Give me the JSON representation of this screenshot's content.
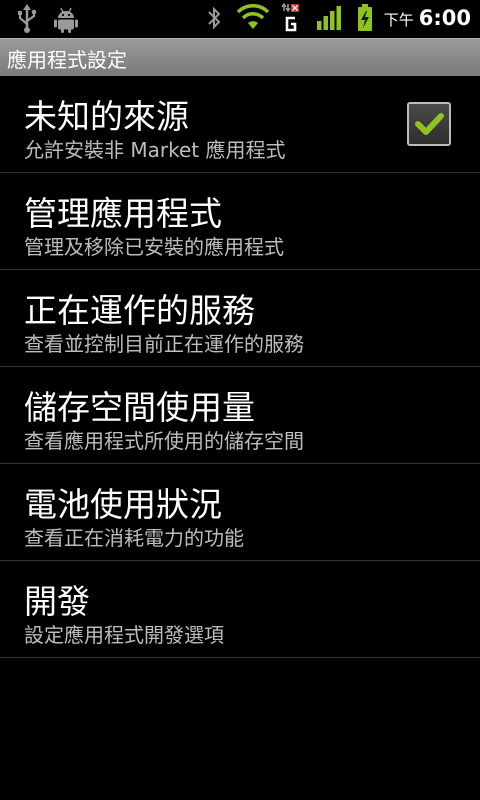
{
  "status_bar": {
    "icons": [
      "usb-icon",
      "android-debug-icon",
      "bluetooth-icon",
      "wifi-icon",
      "gprs-g-icon",
      "signal-icon",
      "battery-charging-icon"
    ],
    "colors": {
      "active_green": "#8fc31f",
      "icon_gray": "#9a9a9a"
    },
    "ampm": "下午",
    "time": "6:00"
  },
  "title_bar": {
    "title": "應用程式設定"
  },
  "settings": [
    {
      "title": "未知的來源",
      "summary": "允許安裝非 Market 應用程式",
      "has_checkbox": true,
      "checked": true
    },
    {
      "title": "管理應用程式",
      "summary": "管理及移除已安裝的應用程式"
    },
    {
      "title": "正在運作的服務",
      "summary": "查看並控制目前正在運作的服務"
    },
    {
      "title": "儲存空間使用量",
      "summary": "查看應用程式所使用的儲存空間"
    },
    {
      "title": "電池使用狀況",
      "summary": "查看正在消耗電力的功能"
    },
    {
      "title": "開發",
      "summary": "設定應用程式開發選項"
    }
  ]
}
